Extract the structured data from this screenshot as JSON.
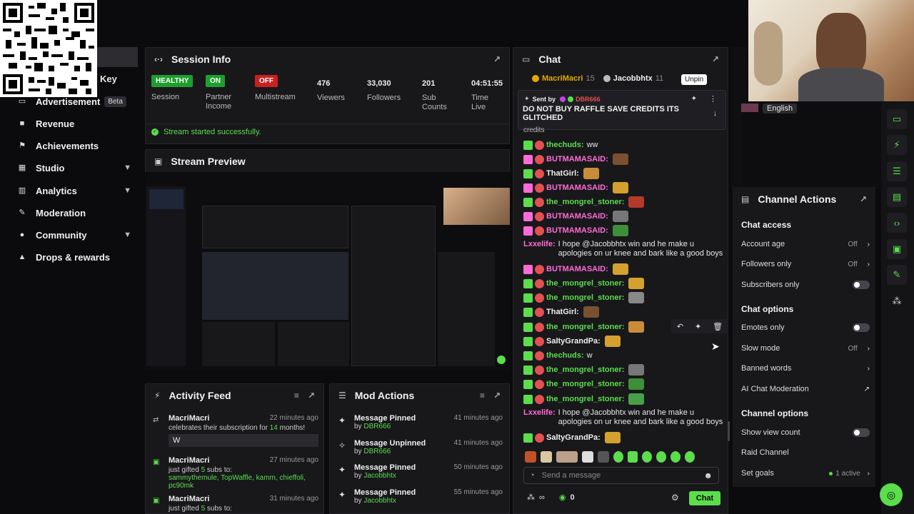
{
  "sidebar": {
    "key_label": "Key",
    "items": [
      {
        "label": "Advertisement",
        "badge": "Beta",
        "icon": "advertisement-icon"
      },
      {
        "label": "Revenue",
        "icon": "revenue-icon"
      },
      {
        "label": "Achievements",
        "icon": "achievements-icon"
      },
      {
        "label": "Studio",
        "icon": "studio-icon",
        "expandable": true
      },
      {
        "label": "Analytics",
        "icon": "analytics-icon",
        "expandable": true
      },
      {
        "label": "Moderation",
        "icon": "moderation-icon"
      },
      {
        "label": "Community",
        "icon": "community-icon",
        "expandable": true
      },
      {
        "label": "Drops & rewards",
        "icon": "drops-icon"
      }
    ]
  },
  "session": {
    "title": "Session Info",
    "stats": [
      {
        "badge": "HEALTHY",
        "badge_color": "#1e9e2e",
        "label": "Session"
      },
      {
        "badge": "ON",
        "badge_color": "#1e9e2e",
        "label": "Partner Income"
      },
      {
        "badge": "OFF",
        "badge_color": "#c92020",
        "label": "Multistream"
      },
      {
        "value": "476",
        "label": "Viewers"
      },
      {
        "value": "33,030",
        "label": "Followers"
      },
      {
        "value": "201",
        "label": "Sub Counts"
      },
      {
        "value": "04:51:55",
        "label": "Time Live"
      }
    ],
    "status": "Stream started successfully."
  },
  "preview": {
    "title": "Stream Preview"
  },
  "activity": {
    "title": "Activity Feed",
    "items": [
      {
        "user": "MacriMacri",
        "time": "22 minutes ago",
        "text_pre": "celebrates their subscription for ",
        "highlight": "14",
        "text_post": " months!",
        "message": "W"
      },
      {
        "user": "MacriMacri",
        "time": "27 minutes ago",
        "text_pre": "just gifted ",
        "highlight": "5",
        "text_post": " subs to:",
        "recipients": "sammythemule, TopWaffle, kamm, chieffoli, pc90mk"
      },
      {
        "user": "MacriMacri",
        "time": "31 minutes ago",
        "text_pre": "just gifted ",
        "highlight": "5",
        "text_post": " subs to:"
      }
    ]
  },
  "mod": {
    "title": "Mod Actions",
    "items": [
      {
        "action": "Message Pinned",
        "by": "by",
        "user": "DBR666",
        "time": "41 minutes ago"
      },
      {
        "action": "Message Unpinned",
        "by": "by",
        "user": "DBR666",
        "time": "41 minutes ago"
      },
      {
        "action": "Message Pinned",
        "by": "by",
        "user": "Jacobbhtx",
        "time": "50 minutes ago"
      },
      {
        "action": "Message Pinned",
        "by": "by",
        "user": "Jacobbhtx",
        "time": "55 minutes ago"
      }
    ]
  },
  "chat": {
    "title": "Chat",
    "leaders": [
      {
        "name": "MacriMacri",
        "count": "15"
      },
      {
        "name": "Jacobbhtx",
        "count": "11"
      }
    ],
    "unpin_tooltip": "Unpin",
    "pinned": {
      "sent_by": "Sent by",
      "sender": "DBR666",
      "text": "DO NOT BUY RAFFLE SAVE CREDITS ITS GLITCHED",
      "overflow": "credits"
    },
    "messages": [
      {
        "user": "thechuds:",
        "color": "#5bdd4c",
        "text": "ww"
      },
      {
        "user": "BUTMAMASAID:",
        "color": "#ff6bd6",
        "text": ""
      },
      {
        "user": "ThatGirl:",
        "color": "#efeff1",
        "text": ""
      },
      {
        "user": "BUTMAMASAID:",
        "color": "#ff6bd6",
        "text": ""
      },
      {
        "user": "the_mongrel_stoner:",
        "color": "#5bdd4c",
        "text": ""
      },
      {
        "user": "BUTMAMASAID:",
        "color": "#ff6bd6",
        "text": ""
      },
      {
        "user": "BUTMAMASAID:",
        "color": "#ff6bd6",
        "text": ""
      },
      {
        "user": "Lxxelife:",
        "color": "#ff6bd6",
        "text": "I hope @Jacobbhtx win and he make u apologies on ur knee and bark like a good boys"
      },
      {
        "user": "BUTMAMASAID:",
        "color": "#ff6bd6",
        "text": ""
      },
      {
        "user": "the_mongrel_stoner:",
        "color": "#5bdd4c",
        "text": ""
      },
      {
        "user": "the_mongrel_stoner:",
        "color": "#5bdd4c",
        "text": ""
      },
      {
        "user": "ThatGirl:",
        "color": "#efeff1",
        "text": ""
      },
      {
        "user": "the_mongrel_stoner:",
        "color": "#5bdd4c",
        "text": ""
      },
      {
        "user": "SaltyGrandPa:",
        "color": "#efeff1",
        "text": ""
      },
      {
        "user": "thechuds:",
        "color": "#5bdd4c",
        "text": "w"
      },
      {
        "user": "the_mongrel_stoner:",
        "color": "#5bdd4c",
        "text": ""
      },
      {
        "user": "the_mongrel_stoner:",
        "color": "#5bdd4c",
        "text": ""
      },
      {
        "user": "the_mongrel_stoner:",
        "color": "#5bdd4c",
        "text": ""
      },
      {
        "user": "Lxxelife:",
        "color": "#ff6bd6",
        "text": "I hope @Jacobbhtx win and he make u apologies on ur knee and bark like a good boys"
      },
      {
        "user": "SaltyGrandPa:",
        "color": "#efeff1",
        "text": ""
      }
    ],
    "input_placeholder": "Send a message",
    "points": "0",
    "send_label": "Chat"
  },
  "channel_actions": {
    "title": "Channel Actions",
    "chat_access": "Chat access",
    "account_age": "Account age",
    "account_age_val": "Off",
    "followers_only": "Followers only",
    "followers_only_val": "Off",
    "subscribers_only": "Subscribers only",
    "chat_options": "Chat options",
    "emotes_only": "Emotes only",
    "slow_mode": "Slow mode",
    "slow_mode_val": "Off",
    "banned_words": "Banned words",
    "ai_mod": "AI Chat Moderation",
    "channel_options": "Channel options",
    "show_view_count": "Show view count",
    "raid_channel": "Raid Channel",
    "set_goals": "Set goals",
    "goals_val": "1 active"
  },
  "webcam": {
    "language": "English"
  },
  "colors": {
    "accent": "#5bdd4c",
    "panel": "#18181b",
    "bg": "#0b0b0d"
  }
}
